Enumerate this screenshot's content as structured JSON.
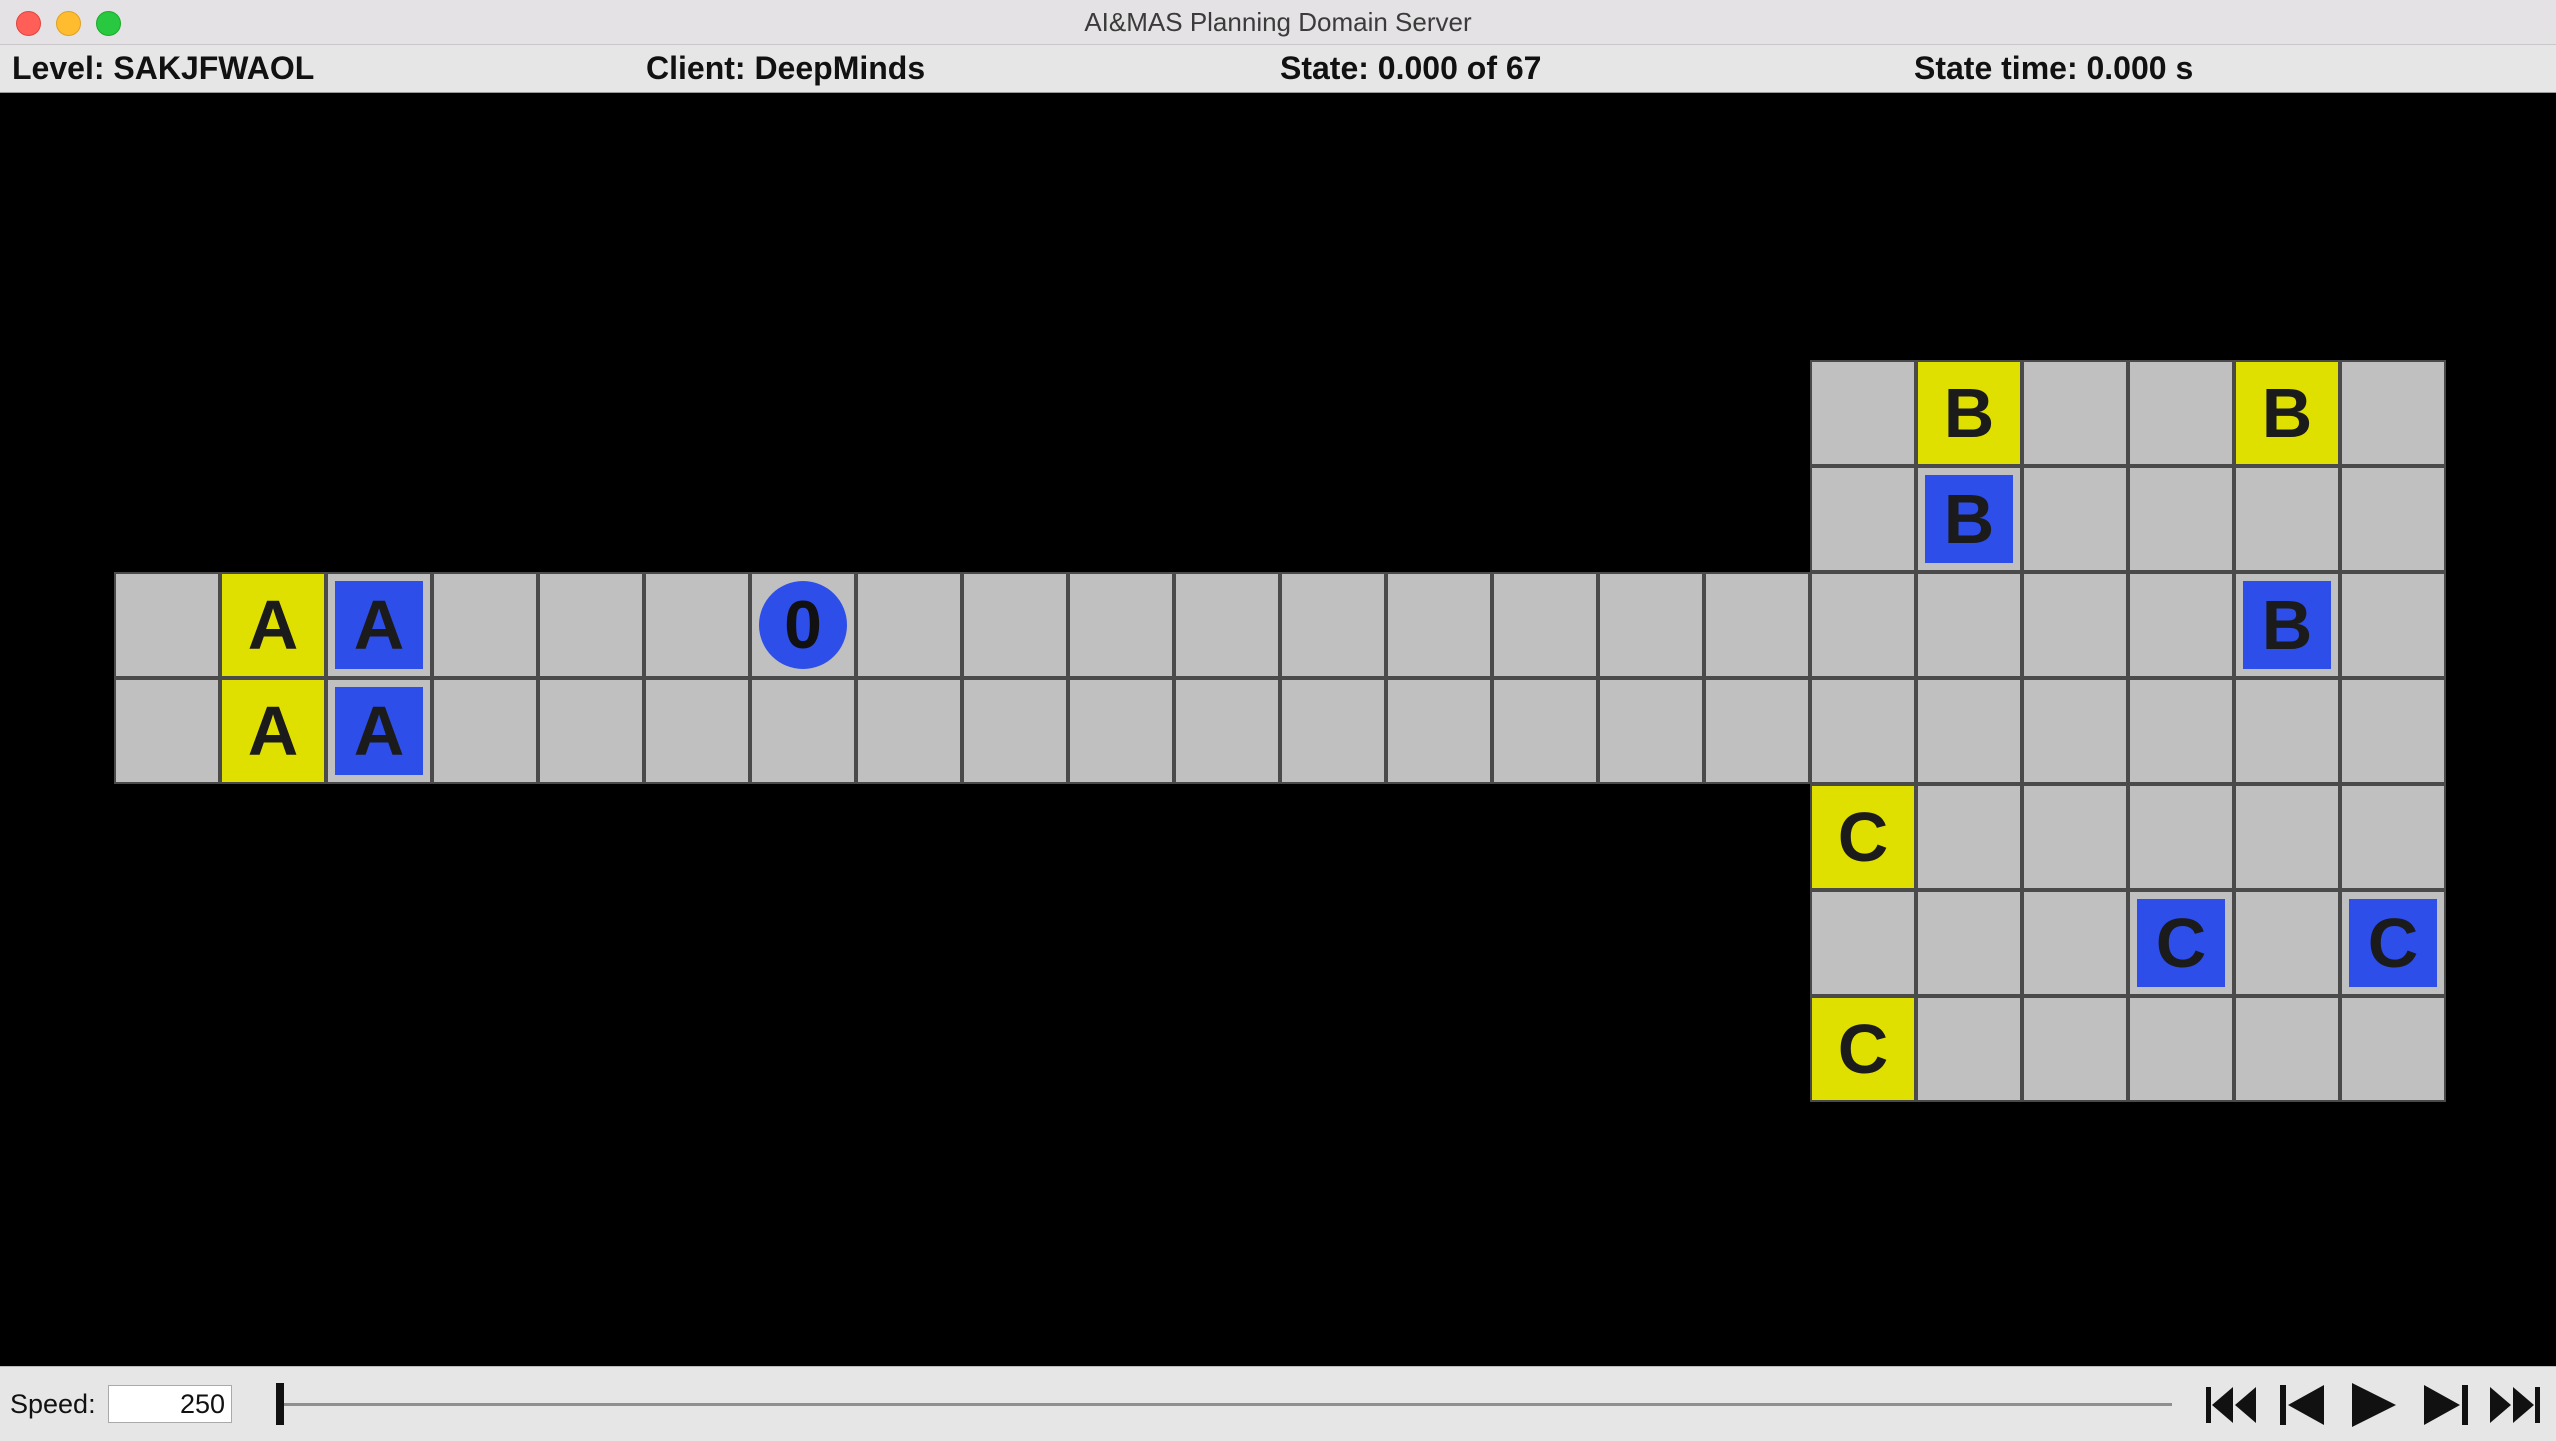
{
  "window": {
    "title": "AI&MAS Planning Domain Server"
  },
  "status": {
    "level": "Level: SAKJFWAOL",
    "client": "Client: DeepMinds",
    "state": "State: 0.000 of 67",
    "state_time": "State time: 0.000 s"
  },
  "level": {
    "colors": {
      "background": "#000000",
      "floor": "#c0c0c0",
      "goal_yellow": "#e0e000",
      "box_blue": "#2d4ee8",
      "agent_blue": "#2d4ee8"
    },
    "goals": [
      {
        "letter": "A"
      },
      {
        "letter": "A"
      },
      {
        "letter": "B"
      },
      {
        "letter": "B"
      },
      {
        "letter": "C"
      },
      {
        "letter": "C"
      }
    ],
    "boxes": [
      {
        "letter": "A"
      },
      {
        "letter": "A"
      },
      {
        "letter": "B"
      },
      {
        "letter": "B"
      },
      {
        "letter": "C"
      },
      {
        "letter": "C"
      }
    ],
    "agent": {
      "label": "0"
    }
  },
  "controls": {
    "speed_label": "Speed:",
    "speed_value": "250",
    "playback_position": 0,
    "buttons": [
      {
        "name": "skip-to-start",
        "icon": "skip-back-icon"
      },
      {
        "name": "step-back",
        "icon": "step-back-icon"
      },
      {
        "name": "play",
        "icon": "play-icon"
      },
      {
        "name": "step-forward",
        "icon": "step-forward-icon"
      },
      {
        "name": "skip-to-end",
        "icon": "skip-forward-icon"
      }
    ]
  }
}
